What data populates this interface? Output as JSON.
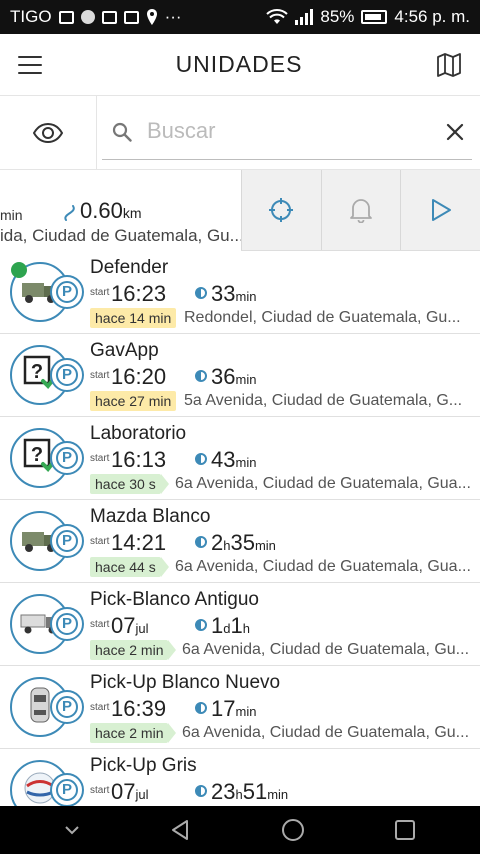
{
  "status_bar": {
    "carrier": "TIGO",
    "battery": "85%",
    "time": "4:56 p. m.",
    "more": "···"
  },
  "app_bar": {
    "title": "UNIDADES",
    "menu_icon": "hamburger-icon",
    "map_icon": "map-icon"
  },
  "search": {
    "placeholder": "Buscar",
    "value": "",
    "visibility_icon": "eye-icon",
    "search_icon": "search-icon",
    "clear_icon": "close-icon"
  },
  "summary": {
    "time_unit": "min",
    "distance": "0.60",
    "distance_unit": "km",
    "address": "ida, Ciudad de Guatemala, Gu...",
    "actions": [
      "locate-icon",
      "bell-icon",
      "play-icon"
    ]
  },
  "units": [
    {
      "name": "Defender",
      "start_label": "start",
      "start": "16:23",
      "start_unit": "",
      "duration": [
        {
          "v": "33",
          "u": "min"
        }
      ],
      "ago": "hace 14 min",
      "ago_color": "yellow",
      "address": "Redondel, Ciudad de Guatemala, Gu...",
      "icon": "truck-icon",
      "gps": true
    },
    {
      "name": "GavApp",
      "start_label": "start",
      "start": "16:20",
      "start_unit": "",
      "duration": [
        {
          "v": "36",
          "u": "min"
        }
      ],
      "ago": "hace 27 min",
      "ago_color": "yellow",
      "address": "5a Avenida, Ciudad de Guatemala, G...",
      "icon": "unknown-device-icon",
      "gps": false
    },
    {
      "name": "Laboratorio",
      "start_label": "start",
      "start": "16:13",
      "start_unit": "",
      "duration": [
        {
          "v": "43",
          "u": "min"
        }
      ],
      "ago": "hace 30 s",
      "ago_color": "green",
      "address": "6a Avenida, Ciudad de Guatemala, Gua...",
      "icon": "unknown-device-icon",
      "gps": false
    },
    {
      "name": "Mazda Blanco",
      "start_label": "start",
      "start": "14:21",
      "start_unit": "",
      "duration": [
        {
          "v": "2",
          "u": "h"
        },
        {
          "v": "35",
          "u": "min"
        }
      ],
      "ago": "hace 44 s",
      "ago_color": "green",
      "address": "6a Avenida, Ciudad de Guatemala, Gua...",
      "icon": "truck-icon",
      "gps": false
    },
    {
      "name": "Pick-Blanco Antiguo",
      "start_label": "start",
      "start": "07",
      "start_unit": "jul",
      "duration": [
        {
          "v": "1",
          "u": "d"
        },
        {
          "v": "1",
          "u": "h"
        }
      ],
      "ago": "hace 2 min",
      "ago_color": "green",
      "address": "6a Avenida, Ciudad de Guatemala, Gu...",
      "icon": "semi-truck-icon",
      "gps": false
    },
    {
      "name": "Pick-Up Blanco Nuevo",
      "start_label": "start",
      "start": "16:39",
      "start_unit": "",
      "duration": [
        {
          "v": "17",
          "u": "min"
        }
      ],
      "ago": "hace 2 min",
      "ago_color": "green",
      "address": "6a Avenida, Ciudad de Guatemala, Gu...",
      "icon": "car-top-icon",
      "gps": false
    },
    {
      "name": "Pick-Up Gris",
      "start_label": "start",
      "start": "07",
      "start_unit": "jul",
      "duration": [
        {
          "v": "23",
          "u": "h"
        },
        {
          "v": "51",
          "u": "min"
        }
      ],
      "ago": "",
      "ago_color": "",
      "address": "",
      "icon": "company-logo-icon",
      "gps": false
    }
  ],
  "colors": {
    "accent": "#3d8ab7",
    "badge_yellow": "#fdeaa8",
    "badge_green": "#d8f0d2",
    "gps_green": "#2ea44f"
  },
  "nav_bar": [
    "chevron-down-icon",
    "back-icon",
    "home-icon",
    "recents-icon"
  ]
}
